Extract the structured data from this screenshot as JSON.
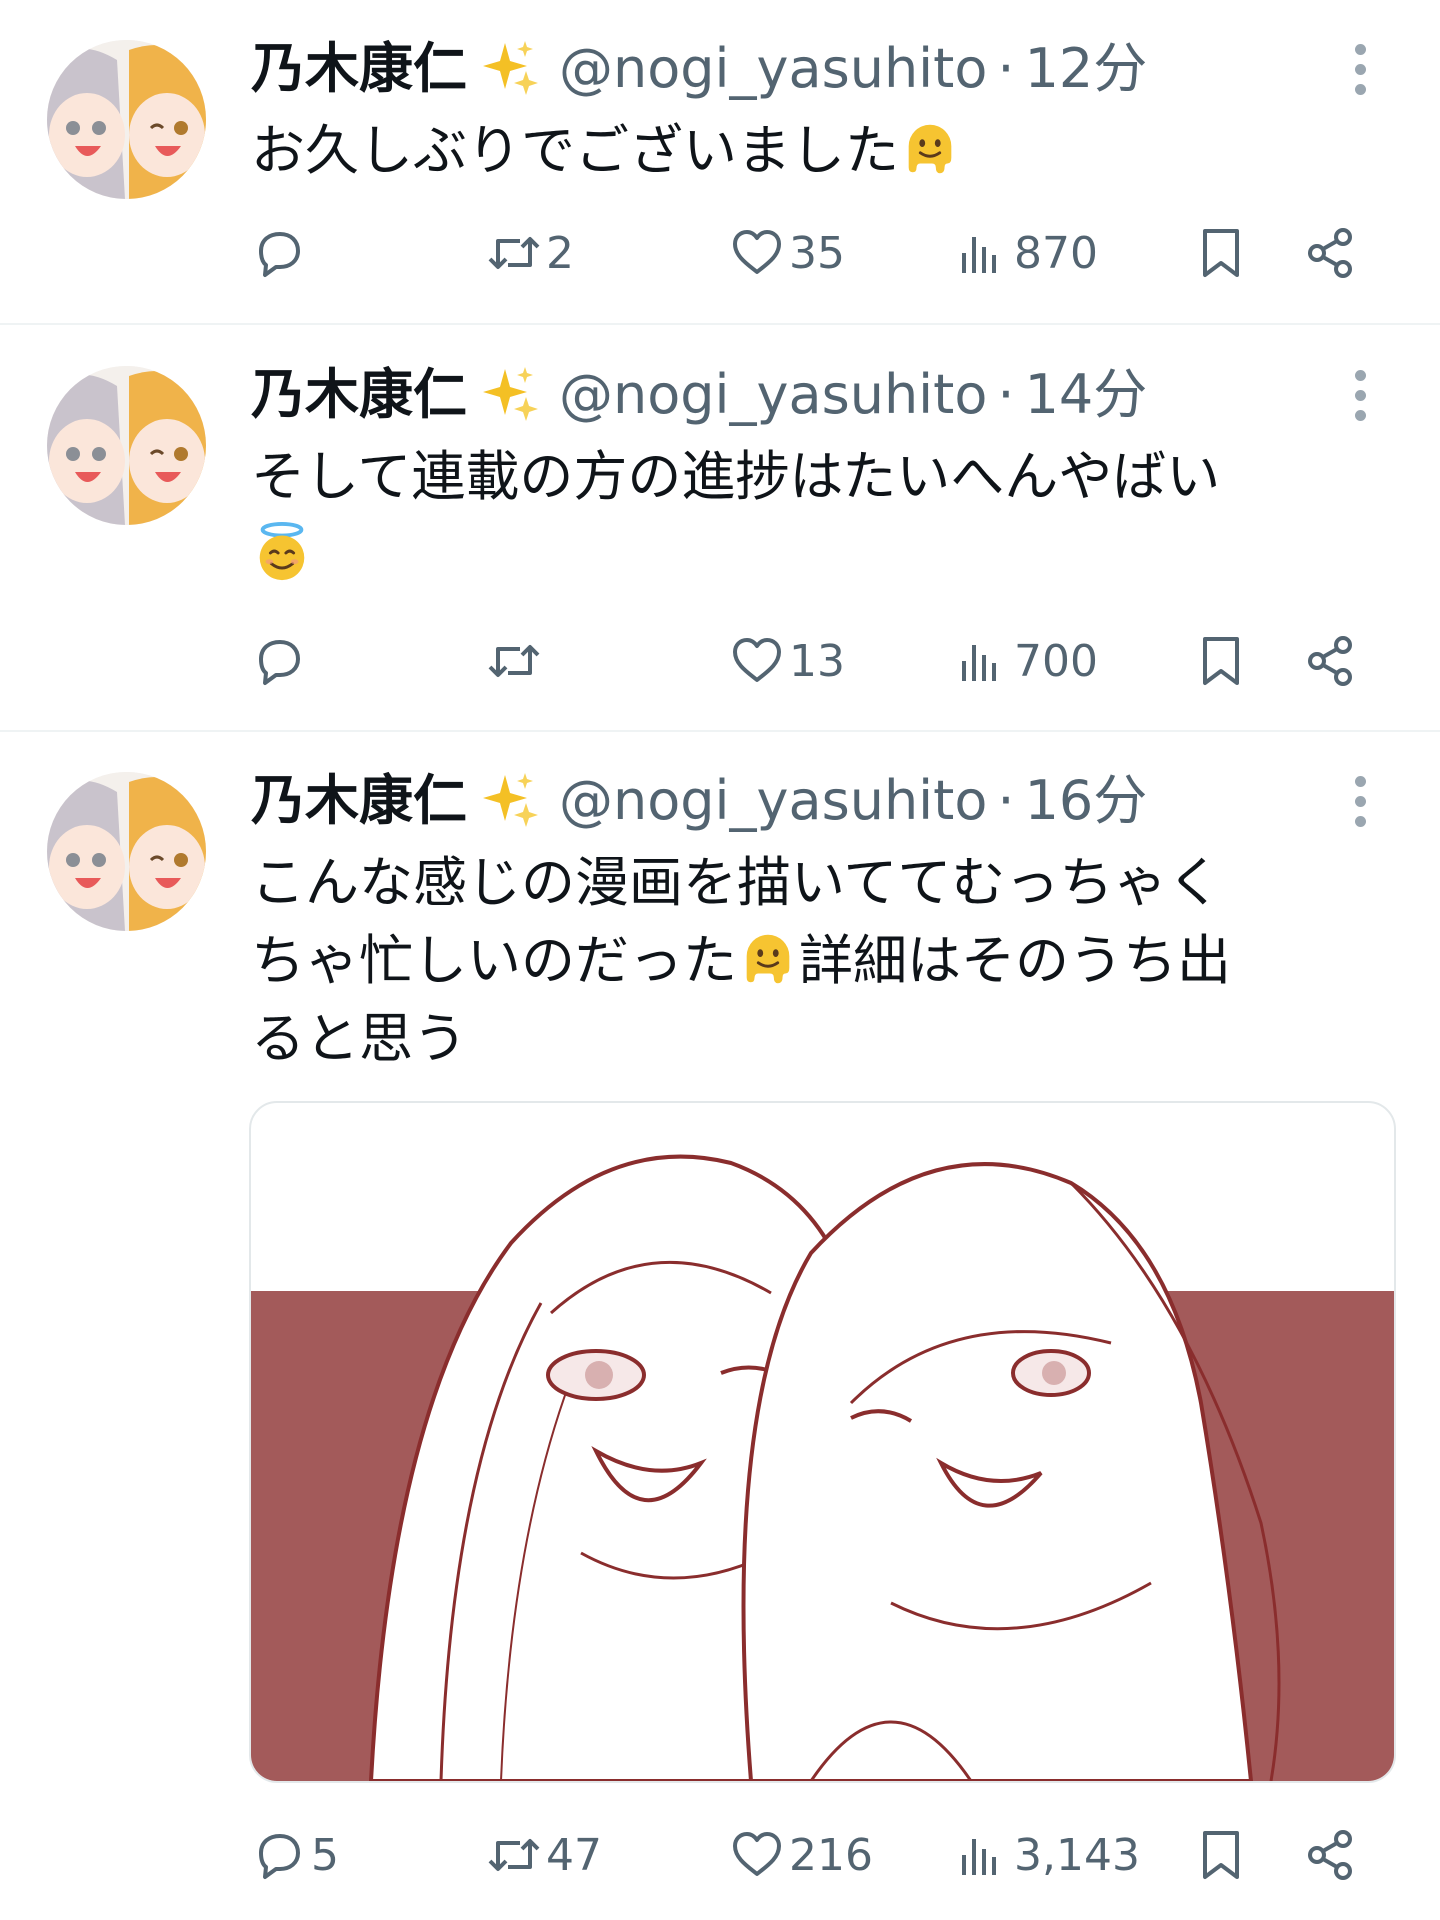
{
  "colors": {
    "text": "#0f1419",
    "muted": "#536471",
    "divider": "#eff3f4",
    "illustration_ink": "#8a2d2d",
    "illustration_band": "#a35a5a"
  },
  "tweets": [
    {
      "name": "乃木康仁",
      "handle": "@nogi_yasuhito",
      "separator": "·",
      "time": "12分",
      "text_parts": [
        "お久しぶりでございました"
      ],
      "emojis": [
        "melting-face-emoji"
      ],
      "replies": "",
      "retweets": "2",
      "likes": "35",
      "views": "870"
    },
    {
      "name": "乃木康仁",
      "handle": "@nogi_yasuhito",
      "separator": "·",
      "time": "14分",
      "text_parts": [
        "そして連載の方の進捗はたいへんやばい\n"
      ],
      "emojis": [
        "smiling-face-with-halo-emoji"
      ],
      "replies": "",
      "retweets": "",
      "likes": "13",
      "views": "700"
    },
    {
      "name": "乃木康仁",
      "handle": "@nogi_yasuhito",
      "separator": "·",
      "time": "16分",
      "text_parts": [
        "こんな感じの漫画を描いててむっちゃく\nちゃ忙しいのだった",
        "詳細はそのうち出\nると思う"
      ],
      "emojis": [
        "melting-face-emoji"
      ],
      "media": "manga-illustration-two-girls",
      "replies": "5",
      "retweets": "47",
      "likes": "216",
      "views": "3,143"
    }
  ],
  "icons": {
    "verified_sparkle": "sparkles-emoji",
    "reply": "reply-icon",
    "retweet": "retweet-icon",
    "like": "heart-icon",
    "views": "views-icon",
    "bookmark": "bookmark-icon",
    "share": "share-icon",
    "more": "more-icon"
  }
}
